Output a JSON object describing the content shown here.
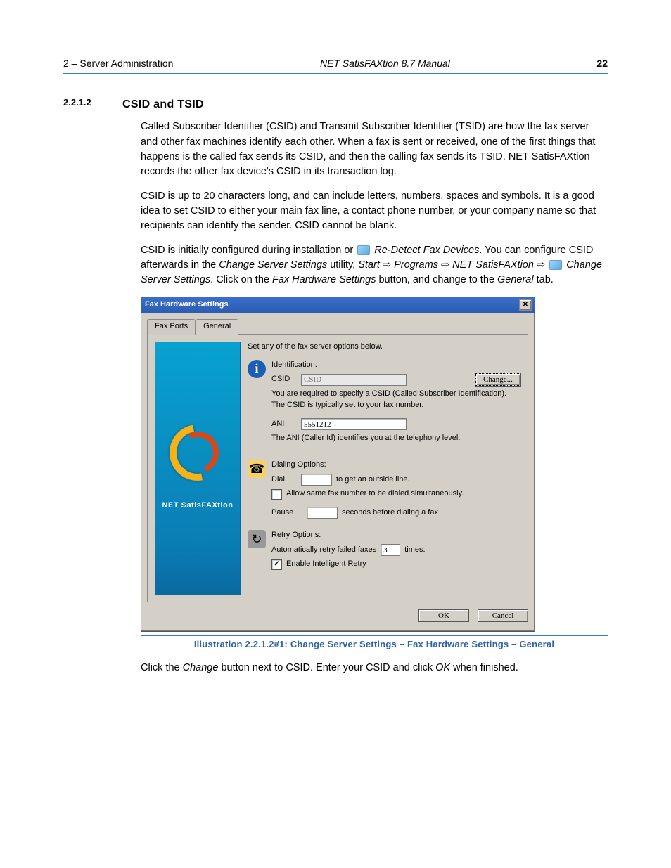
{
  "header": {
    "left": "2 – Server Administration",
    "center": "NET SatisFAXtion 8.7 Manual",
    "page": "22"
  },
  "section": {
    "number": "2.2.1.2",
    "title": "CSID and TSID"
  },
  "para1": "Called Subscriber Identifier (CSID) and Transmit Subscriber Identifier (TSID) are how the fax server and other fax machines identify each other. When a fax is sent or received, one of the first things that happens is the called fax sends its CSID, and then the calling fax sends its TSID. NET SatisFAXtion records the other fax device's CSID in its transaction log.",
  "para2": "CSID is up to 20 characters long, and can include letters, numbers, spaces and symbols. It is a good idea to set CSID to either your main fax line, a contact phone number, or your company name so that recipients can identify the sender. CSID cannot be blank.",
  "para3": {
    "a": "CSID is initially configured during installation or ",
    "b": "Re-Detect Fax Devices",
    "c": ". You can configure CSID afterwards in the ",
    "d": "Change Server Settings",
    "e": " utility, ",
    "f": "Start",
    "g": " ⇨ ",
    "h": "Programs",
    "i": " ⇨ ",
    "j": "NET SatisFAXtion",
    "k": " ⇨ ",
    "l": "Change Server Settings",
    "m": ". Click on the ",
    "n": "Fax Hardware Settings",
    "o": " button, and change to the ",
    "p": "General",
    "q": " tab."
  },
  "caption": "Illustration 2.2.1.2#1: Change Server Settings – Fax Hardware Settings – General",
  "after": {
    "a": "Click the ",
    "b": "Change",
    "c": " button next to CSID. Enter your CSID and click ",
    "d": "OK",
    "e": " when finished."
  },
  "dialog": {
    "title": "Fax Hardware Settings",
    "tabs": {
      "fax_ports": "Fax Ports",
      "general": "General"
    },
    "intro": "Set any of the fax server options below.",
    "side_label": "NET SatisFAXtion",
    "identification": {
      "heading": "Identification:",
      "csid_label": "CSID",
      "csid_placeholder": "CSID",
      "change_button": "Change...",
      "csid_help": "You are required to specify a CSID (Called Subscriber Identification). The CSID is typically set to your fax number.",
      "ani_label": "ANI",
      "ani_value": "5551212",
      "ani_help": "The ANI (Caller Id) identifies you at the telephony level."
    },
    "dialing": {
      "heading": "Dialing Options:",
      "dial_label": "Dial",
      "dial_value": "",
      "dial_suffix": "to get an outside line.",
      "allow_same": "Allow same fax number to be dialed simultaneously.",
      "allow_same_checked": false,
      "pause_label": "Pause",
      "pause_value": "",
      "pause_suffix": "seconds before dialing a fax"
    },
    "retry": {
      "heading": "Retry Options:",
      "auto_label": "Automatically retry failed faxes",
      "auto_value": "3",
      "auto_suffix": "times.",
      "intelligent": "Enable Intelligent Retry",
      "intelligent_checked": true
    },
    "buttons": {
      "ok": "OK",
      "cancel": "Cancel"
    }
  }
}
